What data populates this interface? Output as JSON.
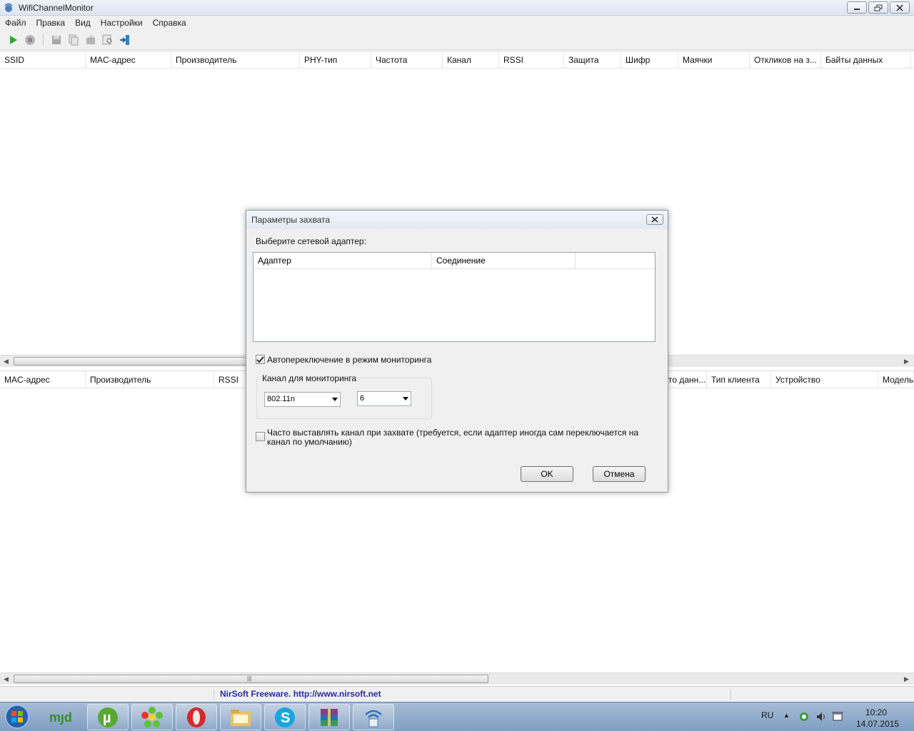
{
  "window": {
    "title": "WifiChannelMonitor"
  },
  "menu": [
    "Файл",
    "Правка",
    "Вид",
    "Настройки",
    "Справка"
  ],
  "toolbar": [
    "play-icon",
    "stop-icon",
    "save-icon",
    "copy-icon",
    "properties-icon",
    "find-icon",
    "exit-icon"
  ],
  "networks_table": {
    "columns": [
      "SSID",
      "MAC-адрес",
      "Производитель",
      "PHY-тип",
      "Частота",
      "Канал",
      "RSSI",
      "Защита",
      "Шифр",
      "Маячки",
      "Откликов на з...",
      "Байты данных"
    ]
  },
  "clients_table": {
    "columns": [
      "MAC-адрес",
      "Производитель",
      "RSSI",
      "...то данн...",
      "Тип клиента",
      "Устройство",
      "Модель"
    ]
  },
  "statusbar": {
    "link": "NirSoft Freeware.  http://www.nirsoft.net"
  },
  "dialog": {
    "title": "Параметры захвата",
    "select_adapter_label": "Выберите сетевой адаптер:",
    "adapter_columns": [
      "Адаптер",
      "Соединение"
    ],
    "auto_monitor_label": "Автопереключение в режим мониторинга",
    "auto_monitor_checked": true,
    "channel_group_label": "Канал для мониторинга",
    "phy_value": "802.11n",
    "channel_value": "6",
    "often_set_label": "Часто выставлять канал при захвате (требуется, если адаптер иногда сам переключается на канал по умолчанию)",
    "often_set_checked": false,
    "ok_label": "OK",
    "cancel_label": "Отмена"
  },
  "taskbar": {
    "apps": [
      "mydefrag",
      "utorrent",
      "icq",
      "opera",
      "explorer",
      "skype",
      "winrar",
      "wifichannelmonitor"
    ],
    "lang": "RU",
    "time": "10:20",
    "date": "14.07.2015"
  }
}
